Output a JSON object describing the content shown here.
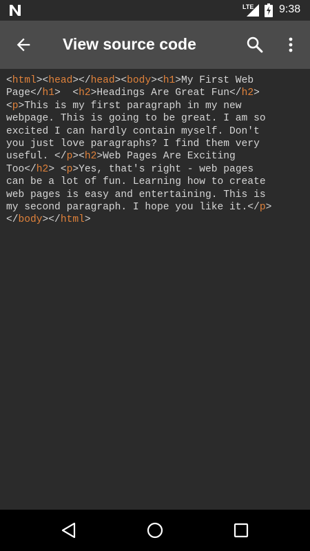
{
  "status_bar": {
    "network": "LTE",
    "time": "9:38",
    "icons": [
      "android-n-icon",
      "signal-icon",
      "battery-icon"
    ]
  },
  "app_bar": {
    "title": "View source code",
    "icons": [
      "back-arrow-icon",
      "search-icon",
      "overflow-menu-icon"
    ]
  },
  "source_lines": [
    [
      {
        "t": "<"
      },
      {
        "g": "html"
      },
      {
        "t": "><"
      },
      {
        "g": "head"
      },
      {
        "t": "></"
      },
      {
        "g": "head"
      },
      {
        "t": "><"
      },
      {
        "g": "body"
      },
      {
        "t": "><"
      },
      {
        "g": "h1"
      },
      {
        "t": ">My First Web"
      }
    ],
    [
      {
        "t": "Page</"
      },
      {
        "g": "h1"
      },
      {
        "t": ">  <"
      },
      {
        "g": "h2"
      },
      {
        "t": ">Headings Are Great Fun</"
      },
      {
        "g": "h2"
      },
      {
        "t": ">"
      }
    ],
    [
      {
        "t": "<"
      },
      {
        "g": "p"
      },
      {
        "t": ">This is my first paragraph in my new"
      }
    ],
    [
      {
        "t": "webpage. This is going to be great. I am so"
      }
    ],
    [
      {
        "t": "excited I can hardly contain myself. Don't"
      }
    ],
    [
      {
        "t": "you just love paragraphs? I find them very"
      }
    ],
    [
      {
        "t": "useful. </"
      },
      {
        "g": "p"
      },
      {
        "t": "><"
      },
      {
        "g": "h2"
      },
      {
        "t": ">Web Pages Are Exciting"
      }
    ],
    [
      {
        "t": "Too</"
      },
      {
        "g": "h2"
      },
      {
        "t": "> <"
      },
      {
        "g": "p"
      },
      {
        "t": ">Yes, that's right - web pages"
      }
    ],
    [
      {
        "t": "can be a lot of fun. Learning how to create"
      }
    ],
    [
      {
        "t": "web pages is easy and entertaining. This is"
      }
    ],
    [
      {
        "t": "my second paragraph. I hope you like it.</"
      },
      {
        "g": "p"
      },
      {
        "t": ">"
      }
    ],
    [
      {
        "t": "</"
      },
      {
        "g": "body"
      },
      {
        "t": "></"
      },
      {
        "g": "html"
      },
      {
        "t": ">"
      }
    ]
  ],
  "nav_bar": {
    "icons": [
      "back-triangle-icon",
      "home-circle-icon",
      "recents-square-icon"
    ]
  },
  "colors": {
    "background": "#2b2b2b",
    "app_bar": "#4b4b4b",
    "text": "#d6d6d6",
    "tag": "#e0823b",
    "nav_bar": "#000000"
  }
}
